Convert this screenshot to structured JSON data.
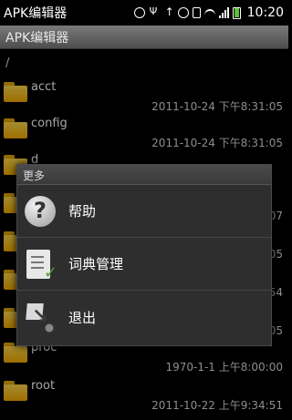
{
  "status_bar": {
    "app_name": "APK编辑器",
    "time": "10:20"
  },
  "app_bar": {
    "title": "APK编辑器"
  },
  "path": "/",
  "files": [
    {
      "name": "acct",
      "date": "2011-10-24 下午8:31:05"
    },
    {
      "name": "config",
      "date": "2011-10-24 下午8:31:05"
    },
    {
      "name": "d",
      "date": ""
    },
    {
      "name": "",
      "date": "07"
    },
    {
      "name": "",
      "date": "05"
    },
    {
      "name": "",
      "date": "54"
    },
    {
      "name": "",
      "date": "05"
    },
    {
      "name": "proc",
      "date": "1970-1-1 上午8:00:00"
    },
    {
      "name": "root",
      "date": "2011-10-22 上午9:34:51"
    }
  ],
  "menu": {
    "title": "更多",
    "items": [
      {
        "label": "帮助",
        "icon": "help-icon"
      },
      {
        "label": "词典管理",
        "icon": "dictionary-icon"
      },
      {
        "label": "退出",
        "icon": "exit-icon"
      }
    ]
  }
}
